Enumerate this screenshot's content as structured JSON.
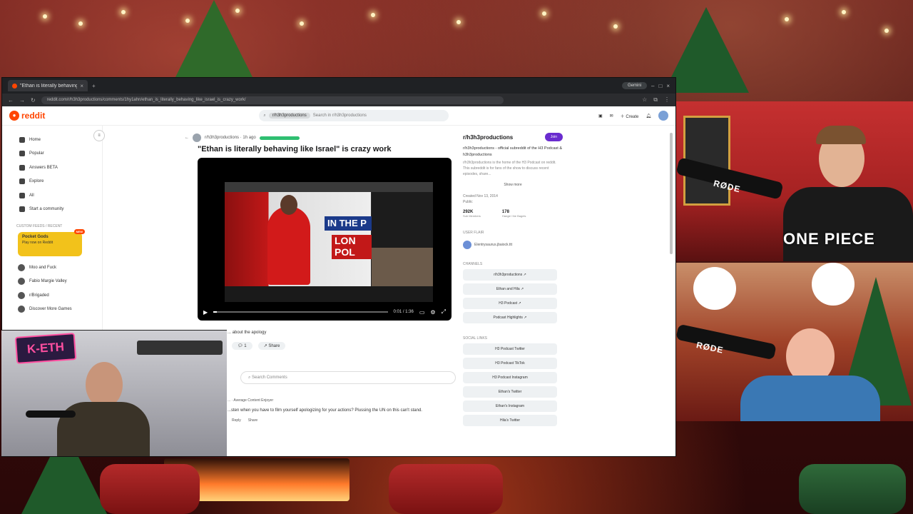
{
  "browser": {
    "tab_title": "\"Ethan is literally behaving like...",
    "tab_close": "×",
    "new_tab": "+",
    "profile_label": "Gemini",
    "url": "reddit.com/r/h3h3productions/comments/1hy1ahn/ethan_is_literally_behaving_like_israel_is_crazy_work/",
    "win_minimize": "–",
    "win_maximize": "□",
    "win_close": "×",
    "nav_back": "←",
    "nav_forward": "→",
    "nav_reload": "↻"
  },
  "reddit": {
    "logo_text": "reddit",
    "search_chip": "r/h3h3productions",
    "search_placeholder": "Search in r/h3h3productions",
    "create_label": "Create",
    "sidebar": {
      "items": [
        {
          "label": "Home"
        },
        {
          "label": "Popular"
        },
        {
          "label": "Answers  BETA"
        },
        {
          "label": "Explore"
        },
        {
          "label": "All"
        },
        {
          "label": "Start a community"
        }
      ],
      "recent_label": "CUSTOM FEEDS / RECENT",
      "promo_title": "Pocket Gods",
      "promo_sub": "Play now on Reddit",
      "promo_badge": "NEW",
      "communities": [
        {
          "label": "Moo and Fuck"
        },
        {
          "label": "Fabio Margie Valley"
        },
        {
          "label": "r/Brigaded"
        },
        {
          "label": "Discover More Games"
        }
      ]
    },
    "post": {
      "subreddit": "r/h3h3productions · 1h ago",
      "title": "\"Ethan is literally behaving like Israel\" is crazy work",
      "video_time": "0:01 / 1:36",
      "video_progress": 0.02,
      "chyron_top": "IN THE P",
      "chyron_bottom": "LON POL",
      "body": "... about the apology",
      "vote_count": "1",
      "share_label": "Share",
      "comment_search": "Search Comments",
      "comment_meta": "... · Average Content Enjoyer",
      "comment_text": "...sten when you have to film yourself apologizing for your actions? Plussing the UN on this can't stand.",
      "reply_label": "Reply",
      "share2_label": "Share"
    },
    "right": {
      "sub_name": "r/h3h3productions",
      "join_label": "Join",
      "desc_title": "r/h3h3productions - official subreddit of the H3 Podcast & h3h3productions",
      "desc_text": "r/h3h3productions is the home of the H3 Podcast on reddit. This subreddit is for fans of the show to discuss recent episodes, share...",
      "show_more": "Show more",
      "created": "Created Nov 13, 2014",
      "visibility": "Public",
      "members": "292K",
      "members_label": "Sub Members",
      "online": "178",
      "online_label": "Hangin' the Bagels",
      "mods_label": "User flair",
      "mod_name": "Elentrysaurus.jbaiock.ttt",
      "channels_label": "Channels",
      "channels": [
        {
          "label": "r/h3h3productions ↗"
        },
        {
          "label": "Ethan and Hila ↗"
        },
        {
          "label": "H3 Podcast ↗"
        },
        {
          "label": "Podcast Highlights ↗"
        }
      ],
      "social_label": "Social Links",
      "socials": [
        {
          "label": "H3 Podcast Twitter"
        },
        {
          "label": "H3 Podcast TikTok"
        },
        {
          "label": "H3 Podcast Instagram"
        },
        {
          "label": "Ethan's Twitter"
        },
        {
          "label": "Ethan's Instagram"
        },
        {
          "label": "Hila's Twitter"
        }
      ]
    }
  },
  "overlay": {
    "keth_logo": "K-ETH",
    "mic_brand_1": "RØDE",
    "mic_brand_2": "RØDE",
    "sweater_text": "ONE PIECE"
  }
}
